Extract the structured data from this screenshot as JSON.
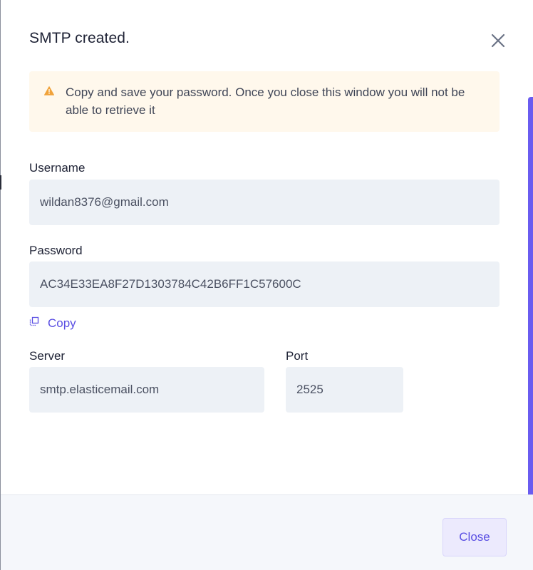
{
  "dialog": {
    "title": "SMTP created.",
    "close_icon": "close-icon"
  },
  "alert": {
    "icon": "warning-icon",
    "text": "Copy and save your password. Once you close this window you will not be able to retrieve it"
  },
  "fields": {
    "username": {
      "label": "Username",
      "value": "wildan8376@gmail.com"
    },
    "password": {
      "label": "Password",
      "value": "AC34E33EA8F27D1303784C42B6FF1C57600C"
    },
    "copy": {
      "icon": "copy-icon",
      "label": "Copy"
    },
    "server": {
      "label": "Server",
      "value": "smtp.elasticemail.com"
    },
    "port": {
      "label": "Port",
      "value": "2525"
    }
  },
  "footer": {
    "close_label": "Close"
  },
  "colors": {
    "accent": "#5a4fe3",
    "warning": "#f0a23a",
    "alert_bg": "#fff8ec",
    "input_bg": "#edf1f6"
  }
}
